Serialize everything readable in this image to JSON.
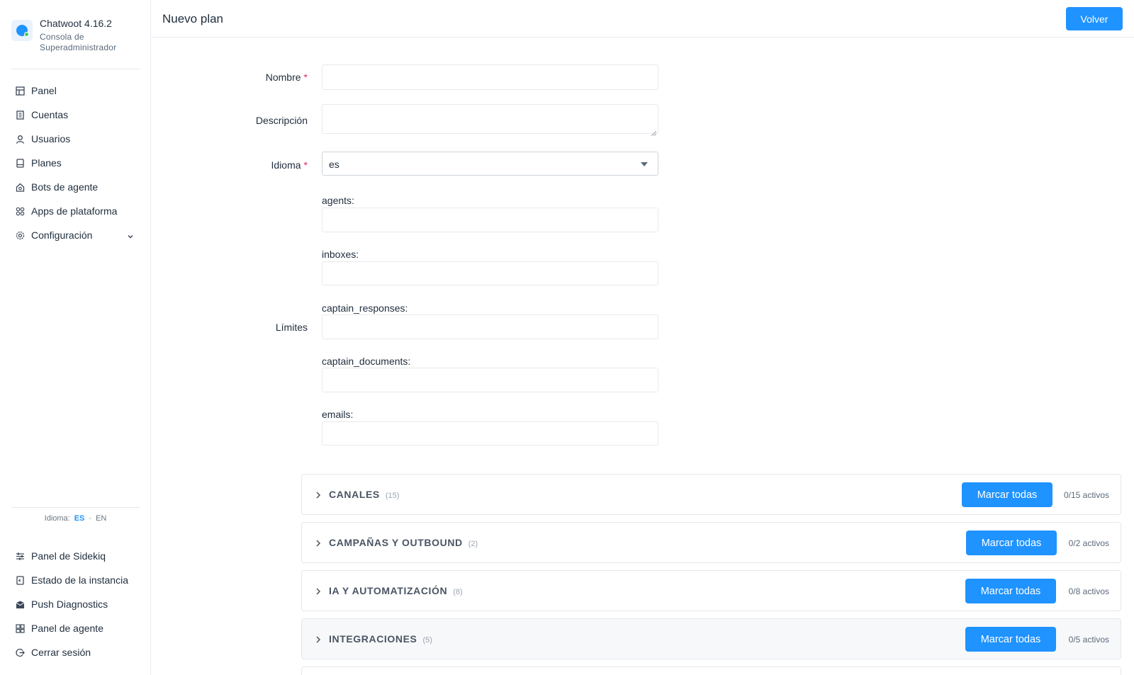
{
  "brand": {
    "title": "Chatwoot 4.16.2",
    "subtitle": "Consola de Superadministrador"
  },
  "sidebar": {
    "items": [
      {
        "label": "Panel",
        "icon": "grid-icon"
      },
      {
        "label": "Cuentas",
        "icon": "building-icon"
      },
      {
        "label": "Usuarios",
        "icon": "user-icon"
      },
      {
        "label": "Planes",
        "icon": "receipt-icon"
      },
      {
        "label": "Bots de agente",
        "icon": "bot-icon"
      },
      {
        "label": "Apps de plataforma",
        "icon": "apps-icon"
      },
      {
        "label": "Configuración",
        "icon": "gear-icon",
        "expandable": true
      }
    ],
    "language": {
      "label": "Idioma:",
      "active": "ES",
      "separator": "·",
      "other": "EN"
    },
    "bottom_items": [
      {
        "label": "Panel de Sidekiq",
        "icon": "sliders-icon"
      },
      {
        "label": "Estado de la instancia",
        "icon": "status-icon"
      },
      {
        "label": "Push Diagnostics",
        "icon": "inbox-icon"
      },
      {
        "label": "Panel de agente",
        "icon": "dashboard-icon"
      },
      {
        "label": "Cerrar sesión",
        "icon": "logout-icon"
      }
    ]
  },
  "header": {
    "title": "Nuevo plan",
    "back_button": "Volver"
  },
  "form": {
    "name_label": "Nombre",
    "required_mark": "*",
    "name_value": "",
    "description_label": "Descripción",
    "description_value": "",
    "language_label": "Idioma",
    "language_value": "es",
    "limits_label": "Límites",
    "limits": [
      {
        "label": "agents:",
        "value": ""
      },
      {
        "label": "inboxes:",
        "value": ""
      },
      {
        "label": "captain_responses:",
        "value": ""
      },
      {
        "label": "captain_documents:",
        "value": ""
      },
      {
        "label": "emails:",
        "value": ""
      }
    ]
  },
  "feature_groups": [
    {
      "title": "CANALES",
      "count": "(15)",
      "button": "Marcar todas",
      "status": "0/15 activos"
    },
    {
      "title": "CAMPAÑAS Y OUTBOUND",
      "count": "(2)",
      "button": "Marcar todas",
      "status": "0/2 activos"
    },
    {
      "title": "IA Y AUTOMATIZACIÓN",
      "count": "(8)",
      "button": "Marcar todas",
      "status": "0/8 activos"
    },
    {
      "title": "INTEGRACIONES",
      "count": "(5)",
      "button": "Marcar todas",
      "status": "0/5 activos"
    }
  ],
  "colors": {
    "accent": "#1f93ff",
    "required": "#e0245e",
    "text": "#1f2d3d",
    "border": "#e4e8ec"
  }
}
